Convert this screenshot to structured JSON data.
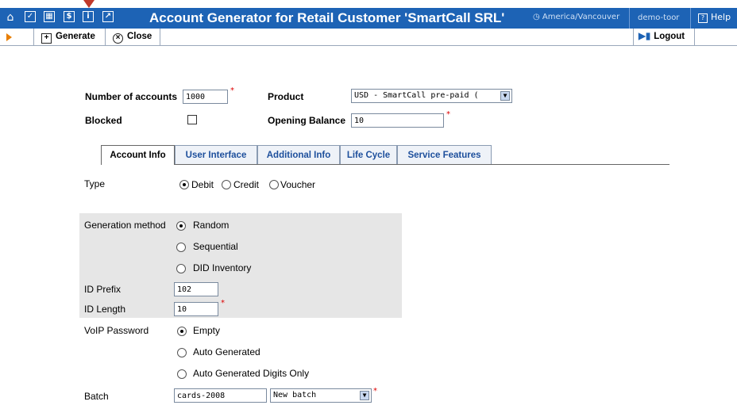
{
  "header": {
    "title": "Account Generator for Retail Customer 'SmartCall SRL'",
    "timezone": "America/Vancouver",
    "user": "demo-toor",
    "help": "Help",
    "icons": [
      "home-icon",
      "checklist-icon",
      "grid-icon",
      "dollar-icon",
      "info-icon",
      "chart-icon"
    ]
  },
  "toolbar": {
    "generate": "Generate",
    "close": "Close",
    "logout": "Logout"
  },
  "form": {
    "num_accounts_label": "Number of accounts",
    "num_accounts_value": "1000",
    "product_label": "Product",
    "product_value": "USD - SmartCall pre-paid (",
    "blocked_label": "Blocked",
    "opening_balance_label": "Opening Balance",
    "opening_balance_value": "10"
  },
  "tabs": [
    {
      "label": "Account Info"
    },
    {
      "label": "User Interface"
    },
    {
      "label": "Additional Info"
    },
    {
      "label": "Life Cycle"
    },
    {
      "label": "Service Features"
    }
  ],
  "account_info": {
    "type_label": "Type",
    "type_options": [
      "Debit",
      "Credit",
      "Voucher"
    ],
    "gen_method_label": "Generation method",
    "gen_options": [
      "Random",
      "Sequential",
      "DID Inventory"
    ],
    "id_prefix_label": "ID Prefix",
    "id_prefix_value": "102",
    "id_length_label": "ID Length",
    "id_length_value": "10",
    "voip_label": "VoIP Password",
    "voip_options": [
      "Empty",
      "Auto Generated",
      "Auto Generated Digits Only"
    ],
    "batch_label": "Batch",
    "batch_value": "cards-2008",
    "batch_select": "New batch"
  },
  "colors": {
    "header_bg": "#1d63b5",
    "required": "#dd0000"
  }
}
